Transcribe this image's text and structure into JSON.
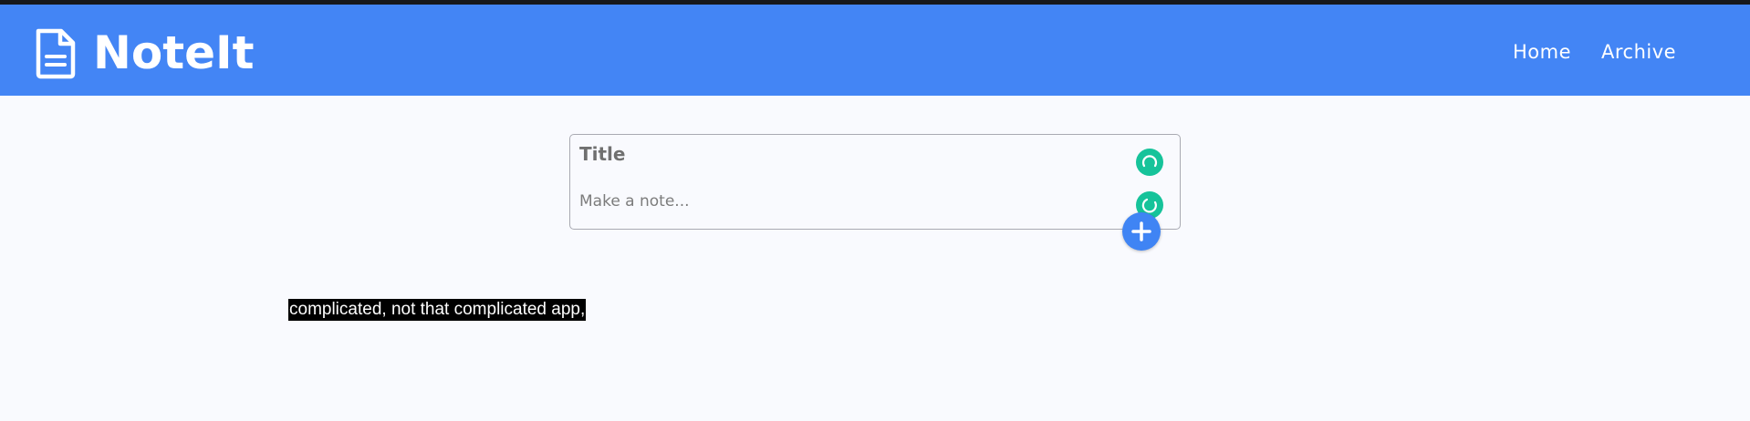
{
  "header": {
    "logo_icon": "document-icon",
    "app_title": "NoteIt",
    "nav": {
      "home": "Home",
      "archive": "Archive"
    },
    "background_color": "#4385f5"
  },
  "note_form": {
    "title_placeholder": "Title",
    "note_placeholder": "Make a note...",
    "add_button_icon": "plus-icon",
    "add_button_color": "#3f84f4",
    "extension_badge_color": "#16c39a"
  },
  "caption": {
    "text": "complicated, not that complicated app,"
  }
}
